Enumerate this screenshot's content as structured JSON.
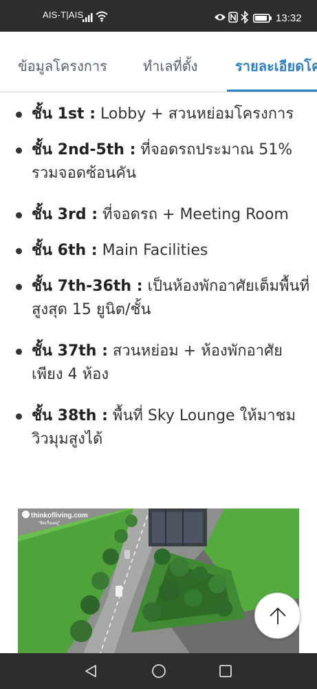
{
  "status_bar": {
    "carrier": "AIS-T|AIS",
    "time": "13:32",
    "icons": [
      "signal-icon",
      "wifi-icon",
      "eye-icon",
      "nfc-icon",
      "bluetooth-icon",
      "battery-icon"
    ]
  },
  "tabs": [
    {
      "label": "ข้อมูลโครงการ",
      "active": false
    },
    {
      "label": "ทำเลที่ตั้ง",
      "active": false
    },
    {
      "label": "รายละเอียดโค",
      "active": true
    }
  ],
  "floors": [
    {
      "label": "ชั้น 1st :",
      "text": " Lobby + สวนหย่อมโครงการ"
    },
    {
      "label": "ชั้น 2nd-5th :",
      "text": " ที่จอดรถประมาณ 51% รวมจอดซ้อนคัน"
    },
    {
      "label": "ชั้น 3rd :",
      "text": " ที่จอดรถ + Meeting Room"
    },
    {
      "label": "ชั้น 6th :",
      "text": " Main Facilities"
    },
    {
      "label": "ชั้น 7th-36th :",
      "text": " เป็นห้องพักอาศัยเต็มพื้นที่ สูงสุด 15 ยูนิต/ชั้น"
    },
    {
      "label": "ชั้น 37th :",
      "text": " สวนหย่อม + ห้องพักอาศัยเพียง 4 ห้อง"
    },
    {
      "label": "ชั้น 38th :",
      "text": " พื้นที่ Sky Lounge ให้มาชมวิวมุมสูงได้"
    }
  ],
  "render_image": {
    "logo_text": "thinkofliving.com",
    "logo_subtext": "\"คิดเรื่องอยู่\""
  },
  "colors": {
    "accent": "#2f7fc1",
    "system_bar": "#2d2d2d",
    "text": "#333333"
  },
  "back_to_top": {
    "icon": "arrow-up-icon"
  },
  "nav_bar": {
    "icons": [
      "nav-back-icon",
      "nav-home-icon",
      "nav-recent-icon"
    ]
  }
}
